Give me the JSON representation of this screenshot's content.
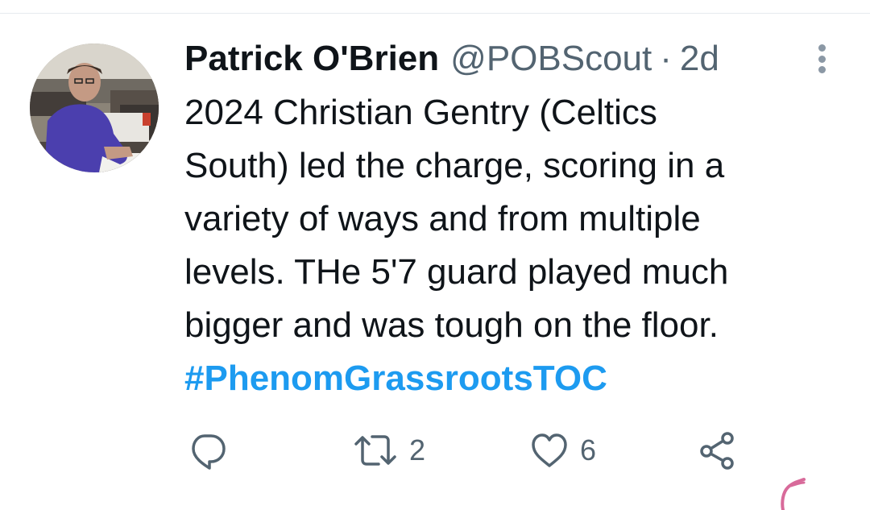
{
  "tweet": {
    "author": {
      "display_name": "Patrick O'Brien",
      "handle": "@POBScout",
      "separator": "·",
      "timestamp": "2d"
    },
    "text_lines": [
      "2024 Christian Gentry (Celtics",
      "South) led the charge, scoring in a",
      "variety of ways and from multiple",
      "levels. THe 5'7 guard played much",
      "bigger and was tough on the floor."
    ],
    "hashtag": "#PhenomGrassrootsTOC",
    "actions": {
      "reply_icon": "reply-icon",
      "retweet_icon": "retweet-icon",
      "retweet_count": "2",
      "like_icon": "heart-icon",
      "like_count": "6",
      "share_icon": "share-icon"
    },
    "more_icon": "more-vertical-icon"
  },
  "colors": {
    "text": "#0f1419",
    "secondary": "#536471",
    "link": "#1d9bf0",
    "divider": "#e6ebef"
  }
}
